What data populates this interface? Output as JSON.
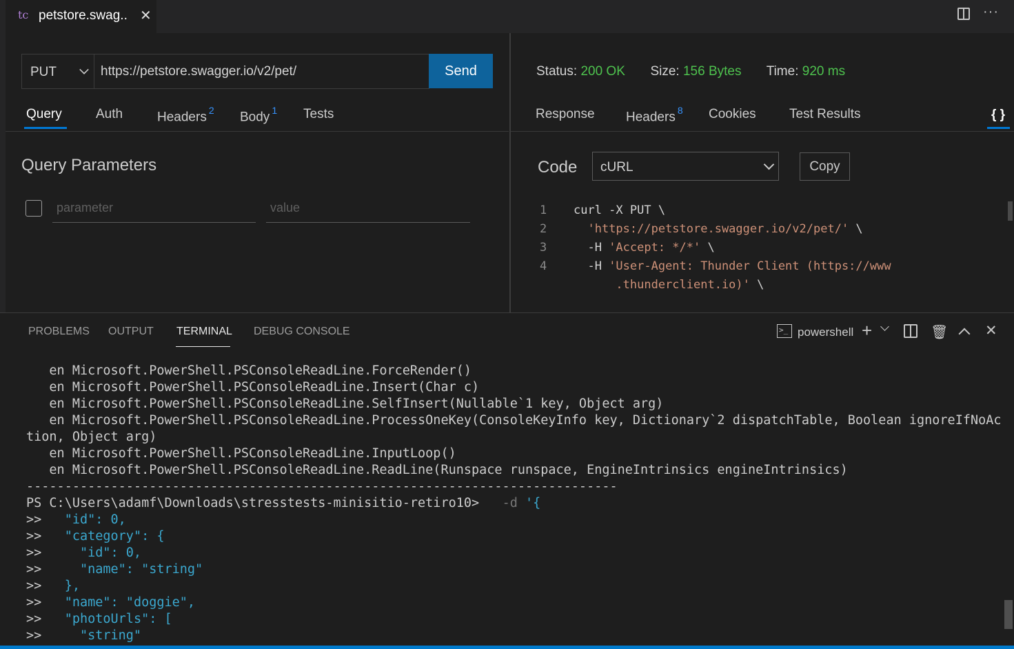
{
  "editor_tab": {
    "icon": "tc",
    "title": "petstore.swag..",
    "close": "✕"
  },
  "toolbar": {
    "more": "···"
  },
  "request": {
    "method": "PUT",
    "url": "https://petstore.swagger.io/v2/pet/",
    "send_label": "Send",
    "tabs": [
      {
        "label": "Query",
        "count": ""
      },
      {
        "label": "Auth",
        "count": ""
      },
      {
        "label": "Headers",
        "count": "2"
      },
      {
        "label": "Body",
        "count": "1"
      },
      {
        "label": "Tests",
        "count": ""
      }
    ],
    "query_title": "Query Parameters",
    "param_placeholder": "parameter",
    "value_placeholder": "value"
  },
  "response": {
    "status_label": "Status:",
    "status_value": "200 OK",
    "size_label": "Size:",
    "size_value": "156 Bytes",
    "time_label": "Time:",
    "time_value": "920 ms",
    "tabs": [
      {
        "label": "Response",
        "count": ""
      },
      {
        "label": "Headers",
        "count": "8"
      },
      {
        "label": "Cookies",
        "count": ""
      },
      {
        "label": "Test Results",
        "count": ""
      }
    ],
    "braces_label": "{ }",
    "code_label": "Code",
    "code_language": "cURL",
    "copy_label": "Copy",
    "code_lines": [
      {
        "num": "1",
        "parts": [
          {
            "t": "curl -X PUT \\",
            "c": "plain"
          }
        ]
      },
      {
        "num": "2",
        "parts": [
          {
            "t": "  ",
            "c": "plain"
          },
          {
            "t": "'https://petstore.swagger.io/v2/pet/'",
            "c": "str"
          },
          {
            "t": " \\",
            "c": "plain"
          }
        ]
      },
      {
        "num": "3",
        "parts": [
          {
            "t": "  -H ",
            "c": "plain"
          },
          {
            "t": "'Accept: */*'",
            "c": "str"
          },
          {
            "t": " \\",
            "c": "plain"
          }
        ]
      },
      {
        "num": "4",
        "parts": [
          {
            "t": "  -H ",
            "c": "plain"
          },
          {
            "t": "'User-Agent: Thunder Client (https://www",
            "c": "str"
          }
        ]
      },
      {
        "num": "",
        "parts": [
          {
            "t": "      ",
            "c": "plain"
          },
          {
            "t": ".thunderclient.io)'",
            "c": "str"
          },
          {
            "t": " \\",
            "c": "plain"
          }
        ]
      }
    ]
  },
  "panel": {
    "tabs": [
      "PROBLEMS",
      "OUTPUT",
      "TERMINAL",
      "DEBUG CONSOLE"
    ],
    "shell": "powershell",
    "icons": [
      "terminal-icon",
      "plus-icon",
      "chevron-down-icon",
      "split-icon",
      "trash-icon",
      "chevron-up-icon",
      "close-icon"
    ]
  },
  "terminal": {
    "lines": [
      [
        {
          "t": "   en Microsoft.PowerShell.PSConsoleReadLine.ForceRender()",
          "c": ""
        }
      ],
      [
        {
          "t": "   en Microsoft.PowerShell.PSConsoleReadLine.Insert(Char c)",
          "c": ""
        }
      ],
      [
        {
          "t": "   en Microsoft.PowerShell.PSConsoleReadLine.SelfInsert(Nullable`1 key, Object arg)",
          "c": ""
        }
      ],
      [
        {
          "t": "   en Microsoft.PowerShell.PSConsoleReadLine.ProcessOneKey(ConsoleKeyInfo key, Dictionary`2 dispatchTable, Boolean ignoreIfNoAc",
          "c": ""
        }
      ],
      [
        {
          "t": "tion, Object arg)",
          "c": ""
        }
      ],
      [
        {
          "t": "   en Microsoft.PowerShell.PSConsoleReadLine.InputLoop()",
          "c": ""
        }
      ],
      [
        {
          "t": "   en Microsoft.PowerShell.PSConsoleReadLine.ReadLine(Runspace runspace, EngineIntrinsics engineIntrinsics)",
          "c": ""
        }
      ],
      [
        {
          "t": "-----------------------------------------------------------------------------",
          "c": ""
        }
      ],
      [
        {
          "t": "PS C:\\Users\\adamf\\Downloads\\stresstests-minisitio-retiro10>   ",
          "c": ""
        },
        {
          "t": "-d",
          "c": "dim"
        },
        {
          "t": " '{",
          "c": "cyan"
        }
      ],
      [
        {
          "t": ">>   ",
          "c": ""
        },
        {
          "t": "\"id\": 0,",
          "c": "cyan"
        }
      ],
      [
        {
          "t": ">>   ",
          "c": ""
        },
        {
          "t": "\"category\": {",
          "c": "cyan"
        }
      ],
      [
        {
          "t": ">>     ",
          "c": ""
        },
        {
          "t": "\"id\": 0,",
          "c": "cyan"
        }
      ],
      [
        {
          "t": ">>     ",
          "c": ""
        },
        {
          "t": "\"name\": \"string\"",
          "c": "cyan"
        }
      ],
      [
        {
          "t": ">>   ",
          "c": ""
        },
        {
          "t": "},",
          "c": "cyan"
        }
      ],
      [
        {
          "t": ">>   ",
          "c": ""
        },
        {
          "t": "\"name\": \"doggie\",",
          "c": "cyan"
        }
      ],
      [
        {
          "t": ">>   ",
          "c": ""
        },
        {
          "t": "\"photoUrls\": [",
          "c": "cyan"
        }
      ],
      [
        {
          "t": ">>     ",
          "c": ""
        },
        {
          "t": "\"string\"",
          "c": "cyan"
        }
      ]
    ]
  }
}
